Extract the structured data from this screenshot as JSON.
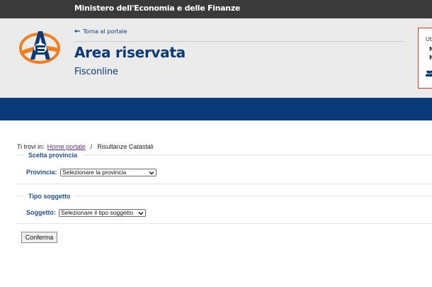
{
  "topbar": {
    "title": "Ministero dell'Economia e delle Finanze"
  },
  "header": {
    "back_link": "Torna al portale",
    "title": "Area riservata",
    "subtitle": "Fisconline"
  },
  "user_box": {
    "label": "Ut",
    "line1": "M",
    "line2": "M"
  },
  "breadcrumb": {
    "prefix": "Ti trovi in:",
    "home": "Home portale",
    "separator": "/",
    "current": "Risultanze Catastali"
  },
  "section1": {
    "legend": "Scelta provincia",
    "label": "Provincia:",
    "select_value": "Selezionare la provincia"
  },
  "section2": {
    "legend": "Tipo soggetto",
    "label": "Soggetto:",
    "select_value": "Selezionare il tipo soggetto"
  },
  "confirm_label": "Conferma",
  "colors": {
    "brand_blue": "#0b3a78",
    "topbar": "#3a3a3a",
    "header_bg": "#ebebeb",
    "accent_red": "#d43b1e",
    "logo_orange": "#f07f1e"
  },
  "icons": {
    "back": "arrow-left-icon",
    "users": "users-icon",
    "logo": "agenzia-entrate-logo"
  }
}
